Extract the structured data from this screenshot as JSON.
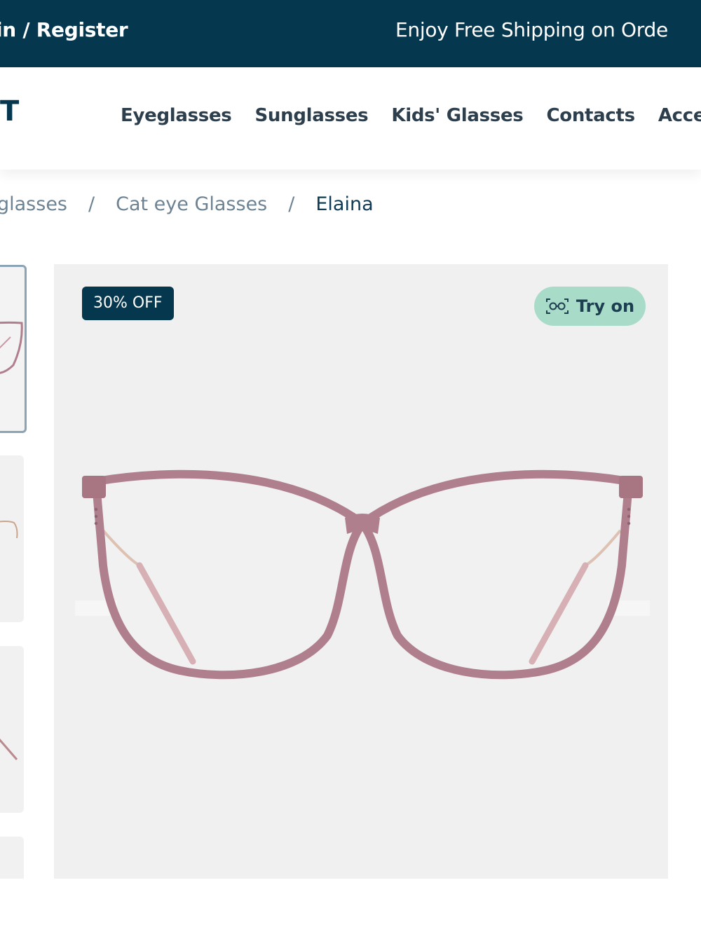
{
  "topbar": {
    "login_register": "in / Register",
    "promo": "Enjoy Free Shipping on Orde"
  },
  "header": {
    "logo": "T",
    "nav": [
      "Eyeglasses",
      "Sunglasses",
      "Kids' Glasses",
      "Contacts",
      "Acces"
    ]
  },
  "breadcrumb": {
    "items": [
      "glasses",
      "Cat eye Glasses",
      "Elaina"
    ],
    "separator": "/"
  },
  "product": {
    "discount_badge": "30% OFF",
    "try_on_label": "Try on",
    "frame_color": "#b07f8e",
    "try_on_icon": "glasses-scan-icon"
  },
  "colors": {
    "brand": "#05374f",
    "accent": "#a9dbc9",
    "image_bg": "#f0f0f0"
  }
}
